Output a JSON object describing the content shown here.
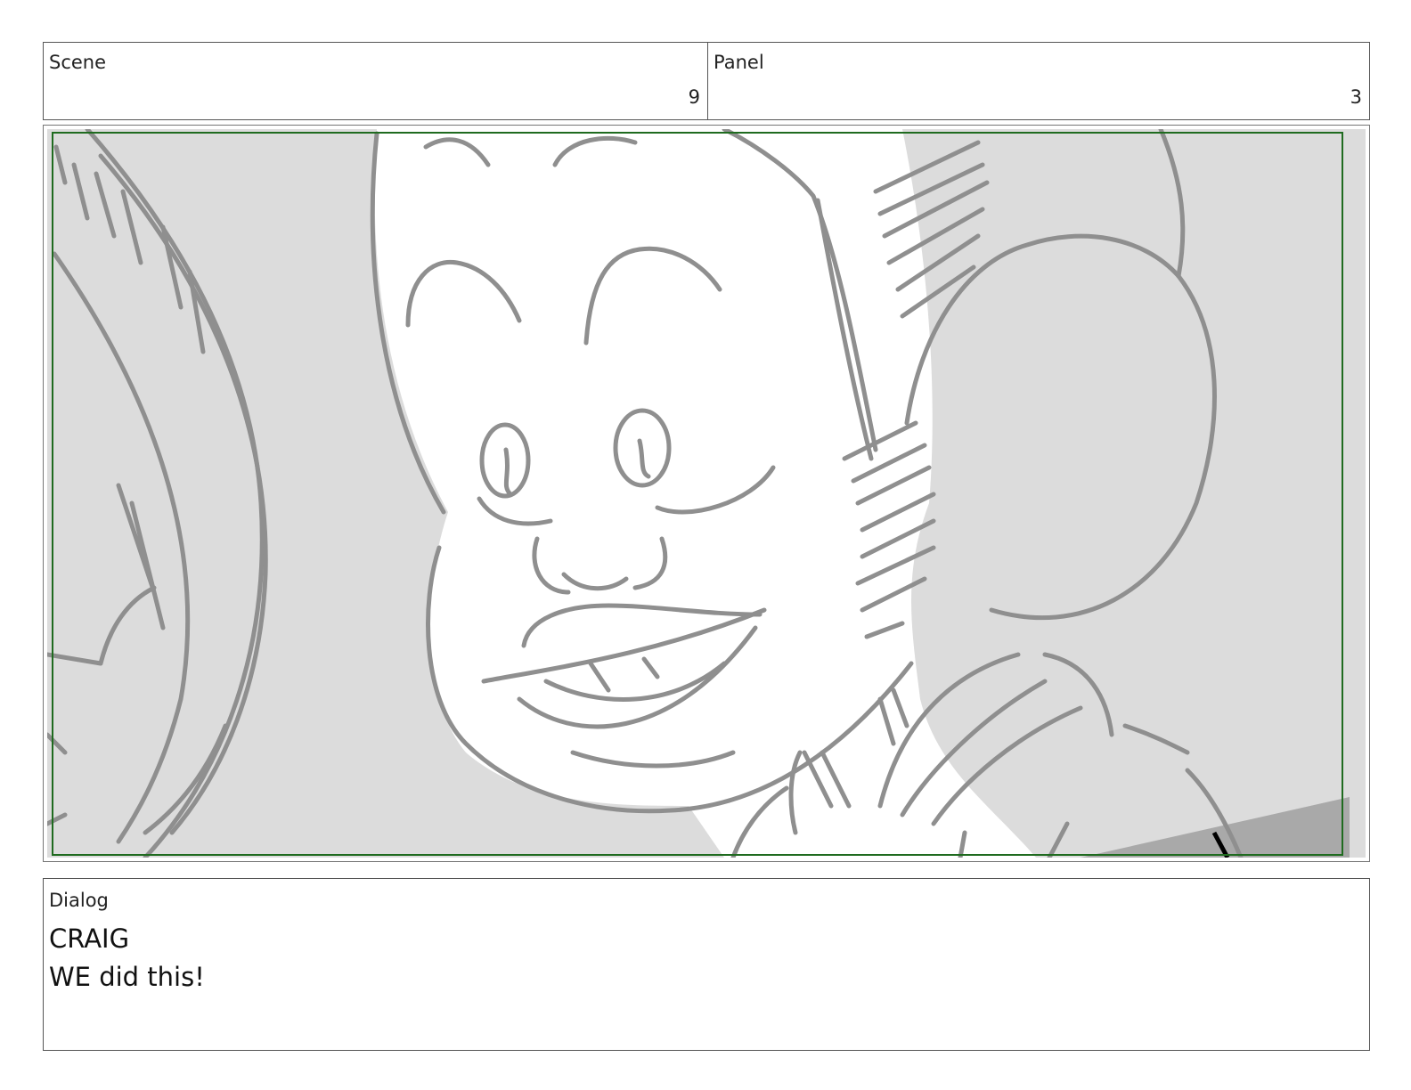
{
  "header": {
    "scene_label": "Scene",
    "scene_value": "9",
    "panel_label": "Panel",
    "panel_value": "3"
  },
  "frame": {
    "safe_area_color": "#1f6b1f",
    "sketch_stroke_color": "#8f8f8f",
    "shadow_fill_color": "#dcdcdc"
  },
  "dialog": {
    "label": "Dialog",
    "speaker": "CRAIG",
    "line": "WE did this!"
  }
}
